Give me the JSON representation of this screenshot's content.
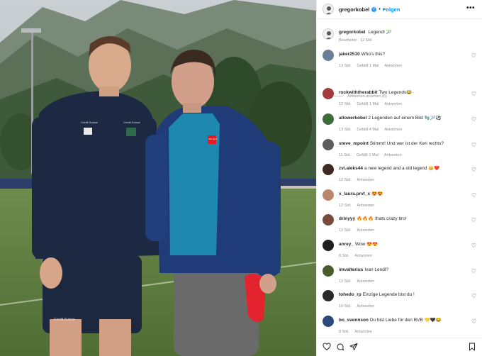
{
  "post": {
    "username": "gregorkobel",
    "verified_mark": "✓",
    "separator": "•",
    "follow_label": "Folgen",
    "more_glyph": "•••",
    "caption": {
      "username": "gregorkobel",
      "text": "Legend! 🎾",
      "edited": "Bearbeitet · 12 Std."
    },
    "photo_text": {
      "badge_left": "Credit Suisse",
      "badge_right": "Credit Suisse",
      "shorts_text": "Credit Suisse",
      "jacket_logo": "UNI QLO"
    },
    "reply_label": "Antworten",
    "view_replies": "Antworten ansehen (6)",
    "heart_glyph": "♡"
  },
  "comments": [
    {
      "user": "jaker2510",
      "text": "Who's this?",
      "time": "13 Std.",
      "likes": "Gefällt 1 Mal",
      "avatar_color": "#6b7f99"
    },
    {
      "user": "rockwiththerabbit",
      "text": "Two Legends😂",
      "time": "12 Std.",
      "likes": "Gefällt 1 Mal",
      "avatar_color": "#a23b3b"
    },
    {
      "user": "allowerkobel",
      "text": "2 Legenden auf einem Bild 🧤🎾⚽",
      "time": "13 Std.",
      "likes": "Gefällt 4 Mal",
      "avatar_color": "#3f6b3a"
    },
    {
      "user": "steve_mpoint",
      "text": "Stimmt! Und wer ist der Keri rechts?",
      "time": "11 Std.",
      "likes": "Gefällt 1 Mal",
      "avatar_color": "#5c5c5c"
    },
    {
      "user": "zvi.aleks44",
      "text": "a new legend and a old legend 👑❤️",
      "time": "12 Std.",
      "likes": "",
      "avatar_color": "#3d2b22"
    },
    {
      "user": "x_laura.prvt_x",
      "text": "😍😍",
      "time": "12 Std.",
      "likes": "",
      "avatar_color": "#b7896a"
    },
    {
      "user": "drinyyy",
      "text": "🔥🔥🔥 thats crazy bro!",
      "time": "12 Std.",
      "likes": "",
      "avatar_color": "#7a4a3a"
    },
    {
      "user": "anrey_",
      "text": "Wow 😍😍",
      "time": "8 Std.",
      "likes": "",
      "avatar_color": "#1e1e1e"
    },
    {
      "user": "imvalterius",
      "text": "Ivan Lendl?",
      "time": "12 Std.",
      "likes": "",
      "avatar_color": "#4a5a2a"
    },
    {
      "user": "tohedo_rp",
      "text": "Einzige Legende bist du !",
      "time": "10 Std.",
      "likes": "",
      "avatar_color": "#2a2a2a"
    },
    {
      "user": "bo_svennson",
      "text": "Du bist Liebe für den BVB 💛🖤😂",
      "time": "8 Std.",
      "likes": "",
      "avatar_color": "#2b4a7a"
    }
  ],
  "icons": [
    "heart-icon",
    "comment-icon",
    "share-icon",
    "bookmark-icon"
  ]
}
